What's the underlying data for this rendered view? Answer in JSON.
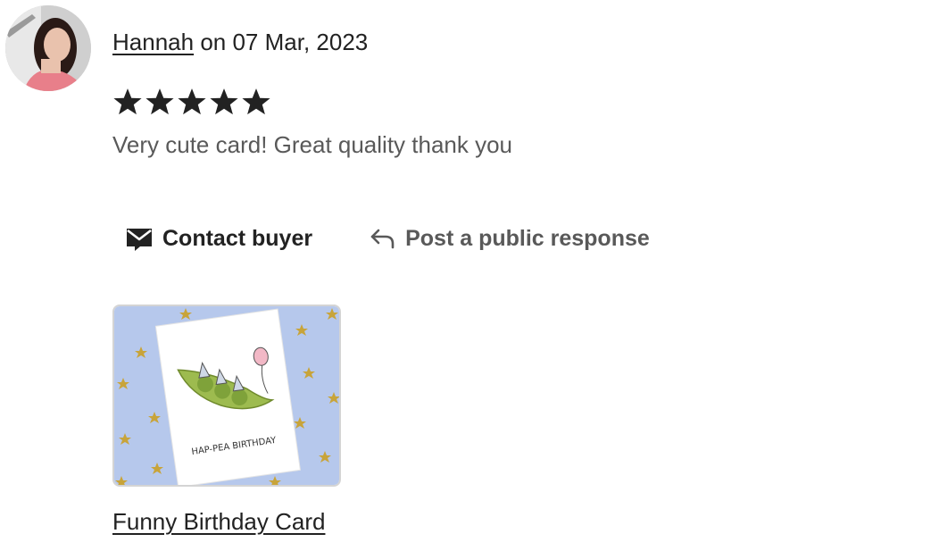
{
  "review": {
    "reviewer_name": "Hannah",
    "date_prefix": "on",
    "date": "07 Mar, 2023",
    "rating": 5,
    "rating_max": 5,
    "text": "Very cute card! Great quality thank you"
  },
  "actions": {
    "contact_label": "Contact buyer",
    "contact_icon": "envelope-icon",
    "public_response_label": "Post a public response",
    "public_response_icon": "reply-arrow-icon"
  },
  "listing": {
    "card_text": "HAP-PEA BIRTHDAY",
    "title": "Funny Birthday Card"
  },
  "colors": {
    "text_primary": "#222222",
    "text_secondary": "#595959",
    "thumb_background": "#b6c8ec",
    "star_gold": "#c8a43a"
  }
}
